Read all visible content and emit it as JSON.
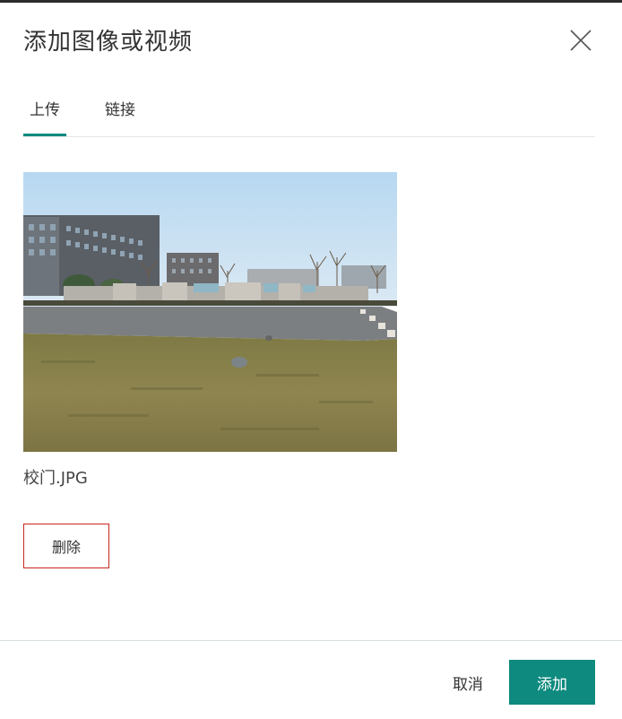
{
  "dialog": {
    "title": "添加图像或视频"
  },
  "tabs": [
    {
      "label": "上传",
      "active": true
    },
    {
      "label": "链接",
      "active": false
    }
  ],
  "upload": {
    "file_name": "校门.JPG",
    "delete_label": "删除"
  },
  "footer": {
    "cancel_label": "取消",
    "add_label": "添加"
  },
  "colors": {
    "accent": "#0e8a7e",
    "delete_border": "#c8281c",
    "text": "#333333"
  },
  "icons": {
    "close": "close-icon"
  }
}
